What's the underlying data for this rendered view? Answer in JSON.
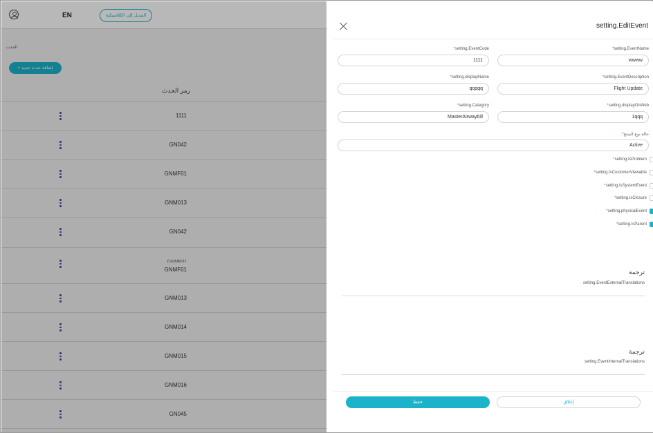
{
  "background": {
    "language": "EN",
    "switch_classic_label": "التبديل إلى الكلاسيكية",
    "breadcrumb": "الحدث",
    "add_event_label": "إضافة حدث جديد",
    "add_icon": "plus-icon",
    "table_header": "رمز الحدث",
    "rows": [
      "1111",
      "GN042",
      "GNMF01",
      "GNM013",
      "GN042",
      "GNMF01",
      "GNM013",
      "GNM014",
      "GNM015",
      "GNM016",
      "GN045"
    ],
    "ghost_row": "GNMF01"
  },
  "drawer": {
    "title": "setting.EditEvent",
    "fields": {
      "event_code": {
        "label": "setting.EventCode",
        "value": "1111"
      },
      "event_name": {
        "label": "setting.EventName",
        "value": "wwww"
      },
      "display_name": {
        "label": "setting.displayName",
        "value": "qqqqq"
      },
      "event_description": {
        "label": "setting.EventDescription",
        "value": "Flight Update"
      },
      "category": {
        "label": "setting.Category",
        "value": "MasterAirwaybill"
      },
      "display_on_web": {
        "label": "setting.displayOnWeb",
        "value": "1qqq"
      },
      "status": {
        "label": "حالة نوع المنتج",
        "value": "Active"
      }
    },
    "checkboxes": [
      {
        "label": "setting.IsProblem",
        "checked": false
      },
      {
        "label": "setting.IsCustomerViewable",
        "checked": false
      },
      {
        "label": "setting.IsSystemEvent",
        "checked": false
      },
      {
        "label": "setting.IsClosure",
        "checked": false
      },
      {
        "label": "setting.physicalEvent",
        "checked": true
      },
      {
        "label": "setting.IsParent",
        "checked": true
      }
    ],
    "external_section": {
      "title": "ترجمة",
      "subtitle": "setting.EventExternalTranslations"
    },
    "internal_section": {
      "title": "ترجمة",
      "subtitle": "setting.EventInternalTranslations"
    },
    "save_label": "حفظ",
    "close_label": "إغلاق"
  },
  "colors": {
    "accent": "#1bb3c9",
    "required": "#e04444"
  }
}
